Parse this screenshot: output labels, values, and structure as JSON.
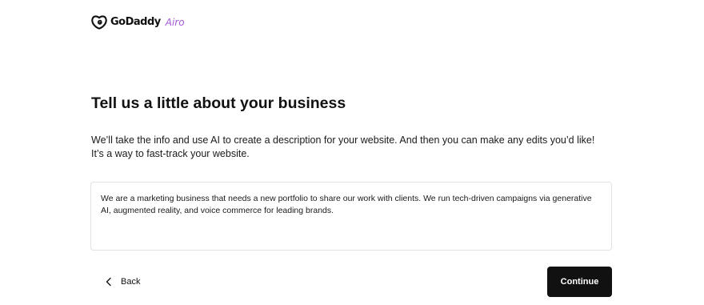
{
  "brand": {
    "name": "GoDaddy",
    "product": "Airo",
    "logo_icon": "godaddy-logo-icon",
    "accent_color": "#a259d9"
  },
  "main": {
    "heading": "Tell us a little about your business",
    "description_line1": "We’ll take the info and use AI to create a description for your website. And then you can make any edits you’d like!",
    "description_line2": "It’s a way to fast-track your website.",
    "business_description_value": "We are a marketing business that needs a new portfolio to share our work with clients. We run tech-driven campaigns via generative AI, augmented reality, and voice commerce for leading brands."
  },
  "footer": {
    "back_label": "Back",
    "back_icon": "chevron-left-icon",
    "continue_label": "Continue",
    "continue_color": "#111111"
  }
}
